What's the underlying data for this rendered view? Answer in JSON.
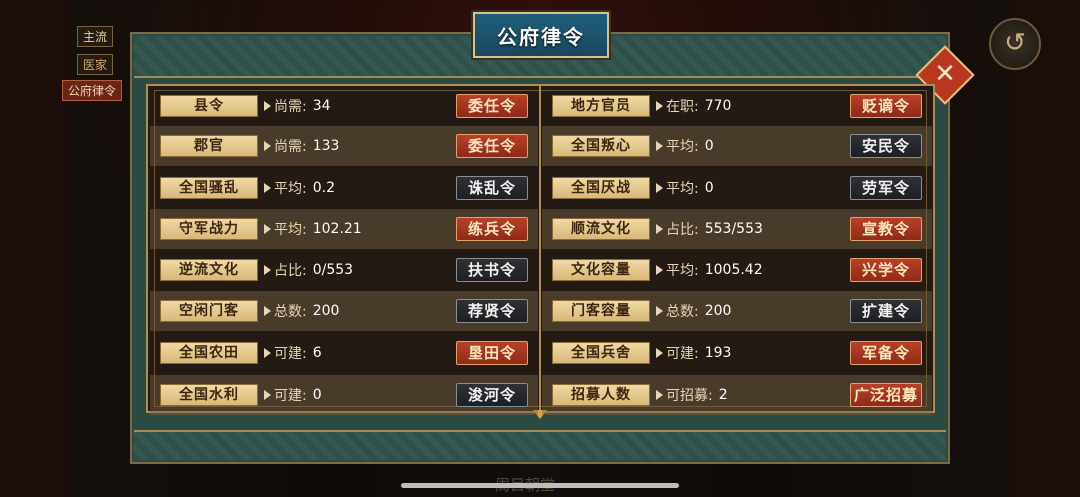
{
  "hud": {
    "tag1": "主流",
    "tag2": "医家",
    "tag3": "公府律令",
    "back_icon": "back-arrow-icon"
  },
  "panel": {
    "title": "公府律令",
    "close_icon": "close-icon",
    "bottom_hint": "周目朝堂"
  },
  "left_rows": [
    {
      "label": "县令",
      "key": "尚需:",
      "value": "34",
      "button": "委任令",
      "style": "red"
    },
    {
      "label": "郡官",
      "key": "尚需:",
      "value": "133",
      "button": "委任令",
      "style": "red"
    },
    {
      "label": "全国骚乱",
      "key": "平均:",
      "value": "0.2",
      "button": "诛乱令",
      "style": "gray"
    },
    {
      "label": "守军战力",
      "key": "平均:",
      "value": "102.21",
      "button": "练兵令",
      "style": "red"
    },
    {
      "label": "逆流文化",
      "key": "占比:",
      "value": "0/553",
      "button": "扶书令",
      "style": "gray"
    },
    {
      "label": "空闲门客",
      "key": "总数:",
      "value": "200",
      "button": "荐贤令",
      "style": "gray"
    },
    {
      "label": "全国农田",
      "key": "可建:",
      "value": "6",
      "button": "垦田令",
      "style": "red"
    },
    {
      "label": "全国水利",
      "key": "可建:",
      "value": "0",
      "button": "浚河令",
      "style": "gray"
    }
  ],
  "right_rows": [
    {
      "label": "地方官员",
      "key": "在职:",
      "value": "770",
      "button": "贬谪令",
      "style": "red"
    },
    {
      "label": "全国叛心",
      "key": "平均:",
      "value": "0",
      "button": "安民令",
      "style": "gray"
    },
    {
      "label": "全国厌战",
      "key": "平均:",
      "value": "0",
      "button": "劳军令",
      "style": "gray"
    },
    {
      "label": "顺流文化",
      "key": "占比:",
      "value": "553/553",
      "button": "宣教令",
      "style": "red"
    },
    {
      "label": "文化容量",
      "key": "平均:",
      "value": "1005.42",
      "button": "兴学令",
      "style": "red"
    },
    {
      "label": "门客容量",
      "key": "总数:",
      "value": "200",
      "button": "扩建令",
      "style": "gray"
    },
    {
      "label": "全国兵舍",
      "key": "可建:",
      "value": "193",
      "button": "军备令",
      "style": "red"
    },
    {
      "label": "招募人数",
      "key": "可招募:",
      "value": "2",
      "button": "广泛招募",
      "style": "red"
    }
  ],
  "colors": {
    "accent_red": "#b94026",
    "gold": "#d8b878",
    "panel_teal": "#2c4a44"
  }
}
